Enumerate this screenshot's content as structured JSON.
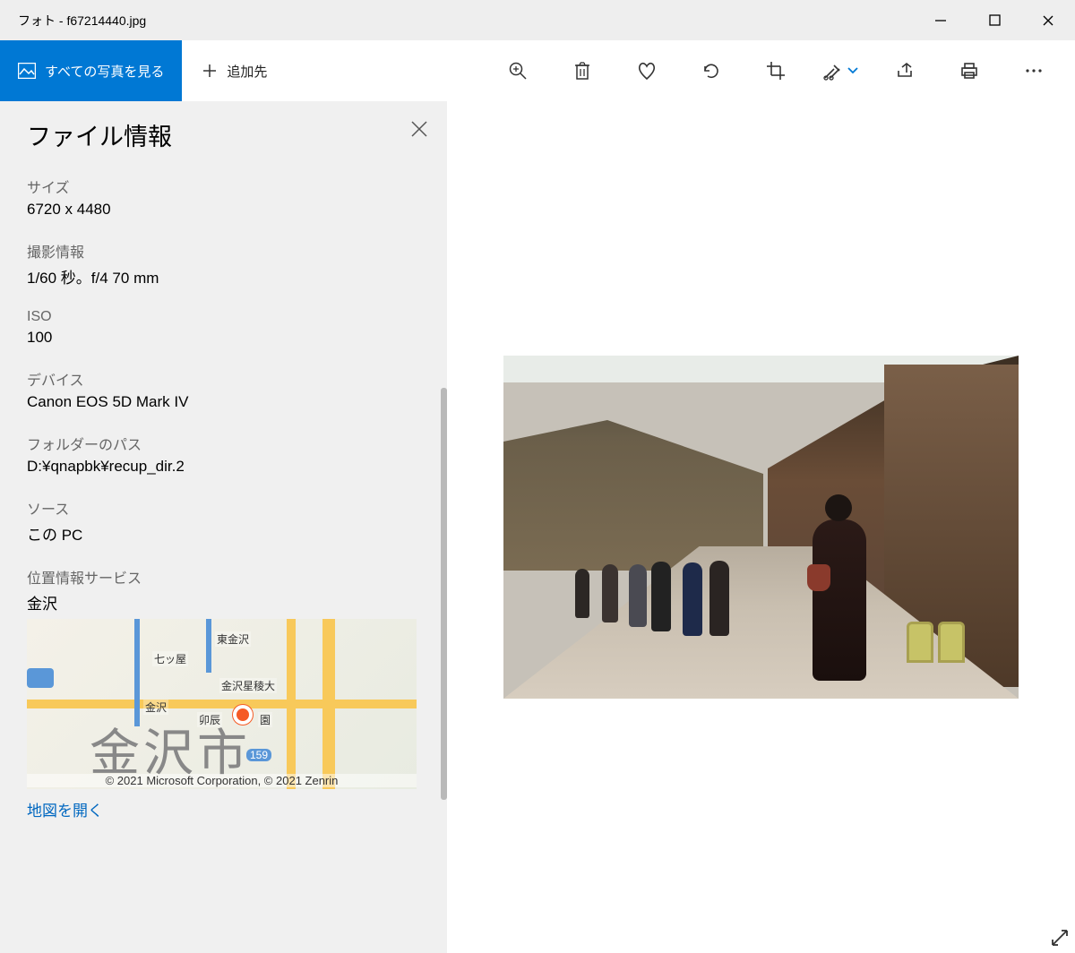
{
  "window": {
    "title": "フォト - f67214440.jpg"
  },
  "toolbar": {
    "view_all_label": "すべての写真を見る",
    "add_label": "追加先"
  },
  "panel": {
    "title": "ファイル情報",
    "size_label": "サイズ",
    "size_value": "6720 x 4480",
    "shoot_label": "撮影情報",
    "shoot_value": "1/60 秒。f/4 70 mm",
    "iso_label": "ISO",
    "iso_value": "100",
    "device_label": "デバイス",
    "device_value": "Canon EOS 5D Mark IV",
    "folder_label": "フォルダーのパス",
    "folder_value": "D:¥qnapbk¥recup_dir.2",
    "source_label": "ソース",
    "source_value": "この PC",
    "location_label": "位置情報サービス",
    "location_value": "金沢",
    "map": {
      "big_label": "金沢市",
      "labels": {
        "higashi": "東金沢",
        "nanatsuya": "七ッ屋",
        "seiryo": "金沢星稜大",
        "kanazawa": "金沢",
        "utatsu": "卯辰",
        "en": "園",
        "route": "159"
      },
      "copyright": "© 2021 Microsoft Corporation, © 2021 Zenrin",
      "open_link": "地図を開く"
    }
  }
}
